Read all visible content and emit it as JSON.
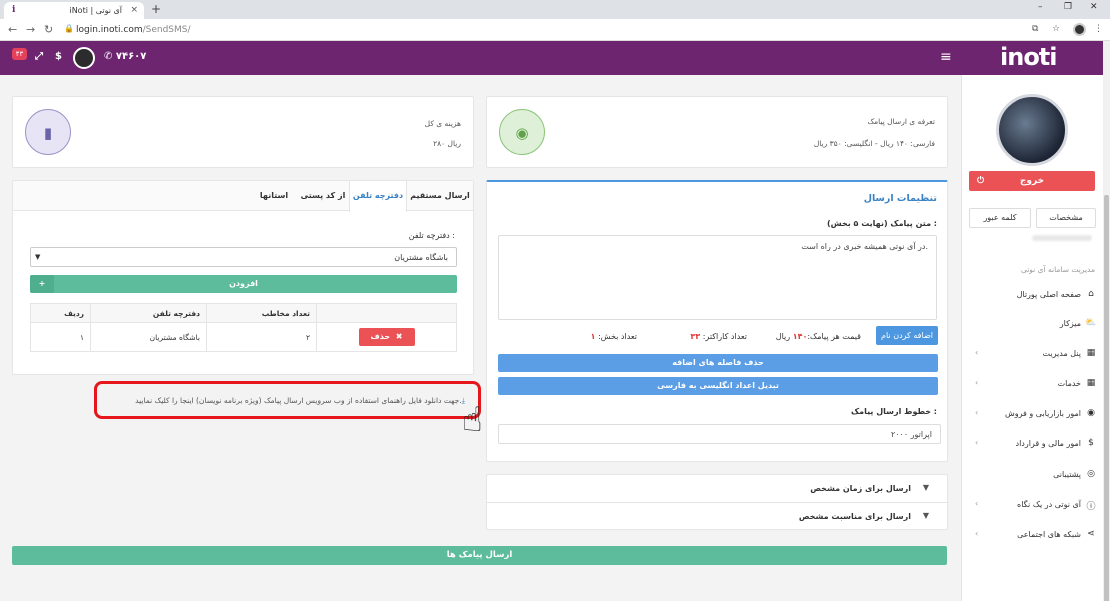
{
  "browser": {
    "tab_title": "iNoti | آی نوتی",
    "favicon": "i",
    "tab_close": "×",
    "new_tab": "+",
    "url_host": "login.inoti.com",
    "url_path": "/SendSMS/",
    "win_min": "–",
    "win_max": "❐",
    "win_close": "✕"
  },
  "header": {
    "logo": "inoti",
    "menu_glyph": "≡",
    "phone": "۷۴۶۰۷",
    "badge": "۴۳"
  },
  "sidebar": {
    "logout": "خروج",
    "tab_profile": "مشخصات",
    "tab_password": "کلمه عبور",
    "heading": "مدیریت سامانه آی نوتی",
    "items": [
      {
        "label": "صفحه اصلی پورتال",
        "icon": "⌂",
        "chevron": ""
      },
      {
        "label": "میزکار",
        "icon": "⛅",
        "chevron": ""
      },
      {
        "label": "پنل مدیریت",
        "icon": "▦",
        "chevron": "‹"
      },
      {
        "label": "خدمات",
        "icon": "▦",
        "chevron": "‹"
      },
      {
        "label": "امور بازاریابی و فروش",
        "icon": "◉",
        "chevron": "‹"
      },
      {
        "label": "امور مالی و قرارداد",
        "icon": "$",
        "chevron": "‹"
      },
      {
        "label": "پشتیبانی",
        "icon": "◎",
        "chevron": ""
      },
      {
        "label": "آی نوتی در یک نگاه",
        "icon": "ⓘ",
        "chevron": "‹"
      },
      {
        "label": "شبکه های اجتماعی",
        "icon": "⋖",
        "chevron": "‹"
      }
    ]
  },
  "tariff": {
    "title": "تعرفه ی ارسال پیامک",
    "detail": "فارسی: ۱۴۰ ریال - انگلیسی: ۳۵۰ ریال"
  },
  "total_cost": {
    "title": "هزینه ی کل",
    "value": "۲۸۰ ریال"
  },
  "settings": {
    "title": "تنظیمات ارسال",
    "message_label": "متن پیامک (نهایت ۵ بخش) :",
    "message_value": "در آی نوتی همیشه خبری در راه است.",
    "add_name": "اضافه کردن نام",
    "price_label": "قیمت هر پیامک:",
    "price_value": "۱۴۰",
    "price_unit": "ریال",
    "chars_label": "تعداد کاراکتر:",
    "chars_value": "۳۳",
    "parts_label": "تعداد بخش:",
    "parts_value": "۱",
    "remove_spaces": "حذف فاصله های اضافه",
    "convert_digits": "تبدیل اعداد انگلیسی به فارسی",
    "line_label": "خطوط ارسال پیامک :",
    "line_value": "اپراتور ۲۰۰۰"
  },
  "schedule": {
    "timed": "ارسال برای زمان مشخص",
    "occasion": "ارسال برای مناسبت مشخص"
  },
  "recipients": {
    "tabs": [
      "ارسال مستقیم",
      "دفترچه تلفن",
      "از کد پستی",
      "استانها"
    ],
    "phonebook_label": "دفترچه تلفن :",
    "phonebook_value": "باشگاه مشتریان",
    "add_button": "افزودن",
    "table_headers": [
      "ردیف",
      "دفترچه تلفن",
      "تعداد مخاطب",
      ""
    ],
    "rows": [
      {
        "index": "۱",
        "book": "باشگاه مشتریان",
        "count": "۲",
        "action": "حذف"
      }
    ]
  },
  "download_note": "جهت دانلود فایل راهنمای استفاده از وب سرویس ارسال پیامک (ویژه برنامه نویسان) اینجا را کلیک نمایید.",
  "send_button": "ارسال پیامک ها"
}
